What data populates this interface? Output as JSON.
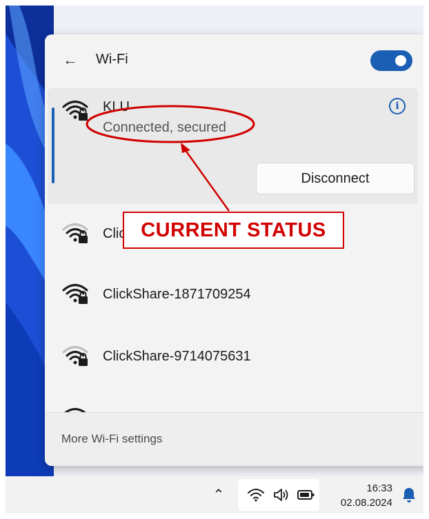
{
  "flyout": {
    "title": "Wi-Fi",
    "wifi_enabled": true,
    "accent_color": "#1a5fb4"
  },
  "networks": [
    {
      "ssid": "KLU",
      "status": "Connected, secured",
      "connected": true,
      "secured": true,
      "action_label": "Disconnect"
    },
    {
      "ssid": "ClickShare",
      "secured": true
    },
    {
      "ssid": "ClickShare-1871709254",
      "secured": true
    },
    {
      "ssid": "ClickShare-9714075631",
      "secured": true
    }
  ],
  "footer": {
    "more_settings_label": "More Wi-Fi settings"
  },
  "annotation": {
    "label": "CURRENT STATUS",
    "color": "#d10000"
  },
  "taskbar": {
    "time": "16:33",
    "date": "02.08.2024",
    "icons": [
      "chevron-up-icon",
      "wifi-icon",
      "speaker-icon",
      "battery-icon",
      "bell-icon"
    ]
  }
}
